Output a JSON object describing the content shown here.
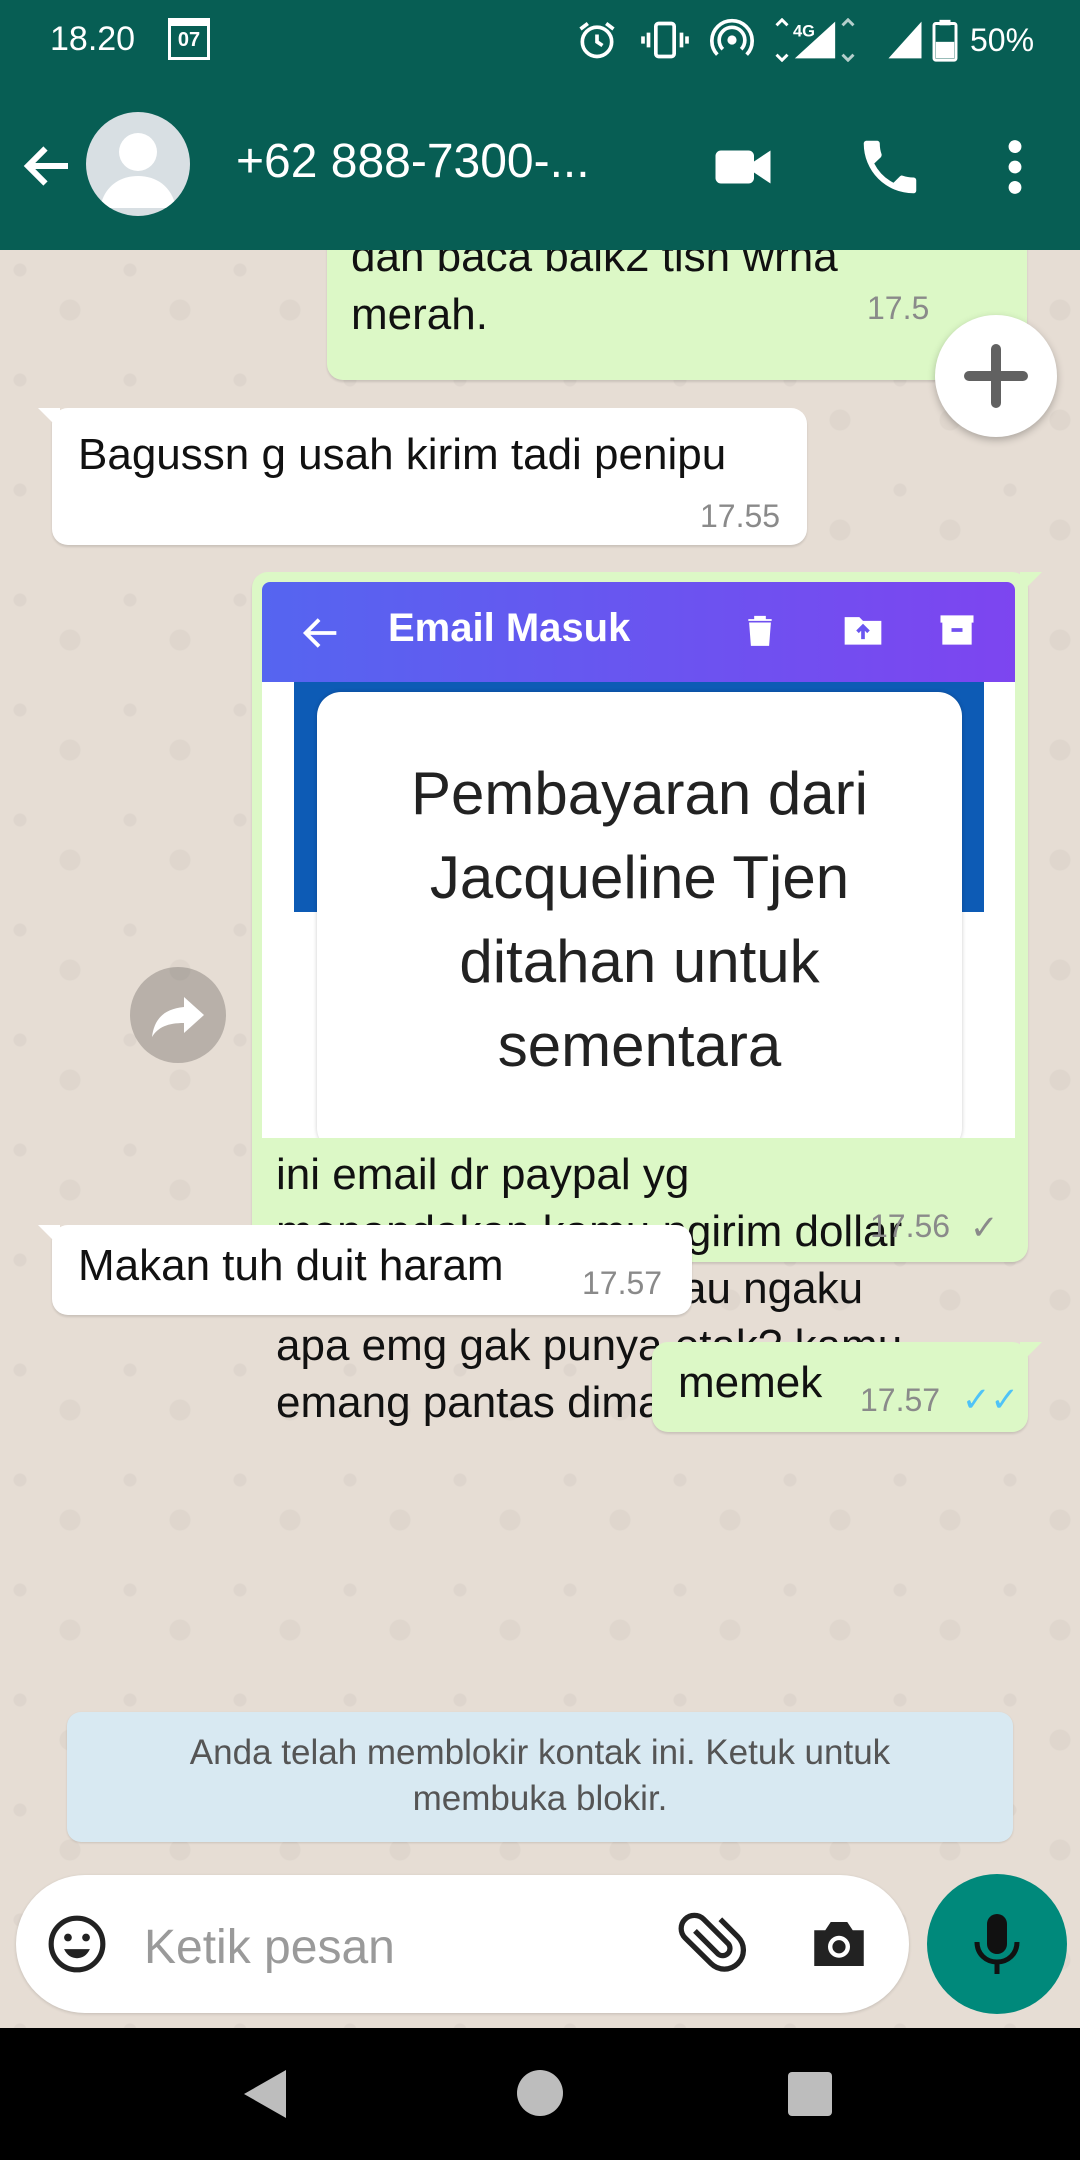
{
  "status_bar": {
    "time": "18.20",
    "calendar_day": "07",
    "network": "4G",
    "battery": "50%"
  },
  "header": {
    "contact_name": "+62 888-7300-..."
  },
  "messages": [
    {
      "direction": "outgoing",
      "lines": [
        "dan baca baik2 tlsn wrna",
        "merah."
      ],
      "time": "17.5"
    },
    {
      "direction": "incoming",
      "text": "Bagussn g usah kirim tadi penipu",
      "time": "17.55"
    },
    {
      "direction": "outgoing",
      "image": {
        "toolbar_title": "Email Masuk",
        "card_lines": [
          "Pembayaran dari",
          "Jacqueline Tjen",
          "ditahan untuk",
          "sementara"
        ]
      },
      "caption_lines": [
        "ini email dr paypal yg",
        "menandakan kamu ngirim dollar",
        "dgn tipe jasa.. gak mau ngaku",
        "apa emg gak punya otak? kamu",
        "emang pantas dimaki."
      ],
      "time": "17.56",
      "status": "sent"
    },
    {
      "direction": "incoming",
      "text": "Makan tuh duit haram",
      "time": "17.57"
    },
    {
      "direction": "outgoing",
      "text": "memek",
      "time": "17.57",
      "status": "read"
    }
  ],
  "blocked_notice": {
    "line1": "Anda telah memblokir kontak ini. Ketuk untuk",
    "line2": "membuka blokir."
  },
  "input": {
    "placeholder": "Ketik pesan"
  },
  "colors": {
    "header": "#075e54",
    "outgoing_bubble": "#dcf8c6",
    "incoming_bubble": "#ffffff",
    "fab": "#00897b",
    "read_ticks": "#4fc3f7"
  },
  "icons": [
    "back-arrow-icon",
    "video-call-icon",
    "phone-icon",
    "more-vert-icon",
    "plus-icon",
    "forward-icon",
    "emoji-icon",
    "attach-icon",
    "camera-icon",
    "mic-icon"
  ]
}
